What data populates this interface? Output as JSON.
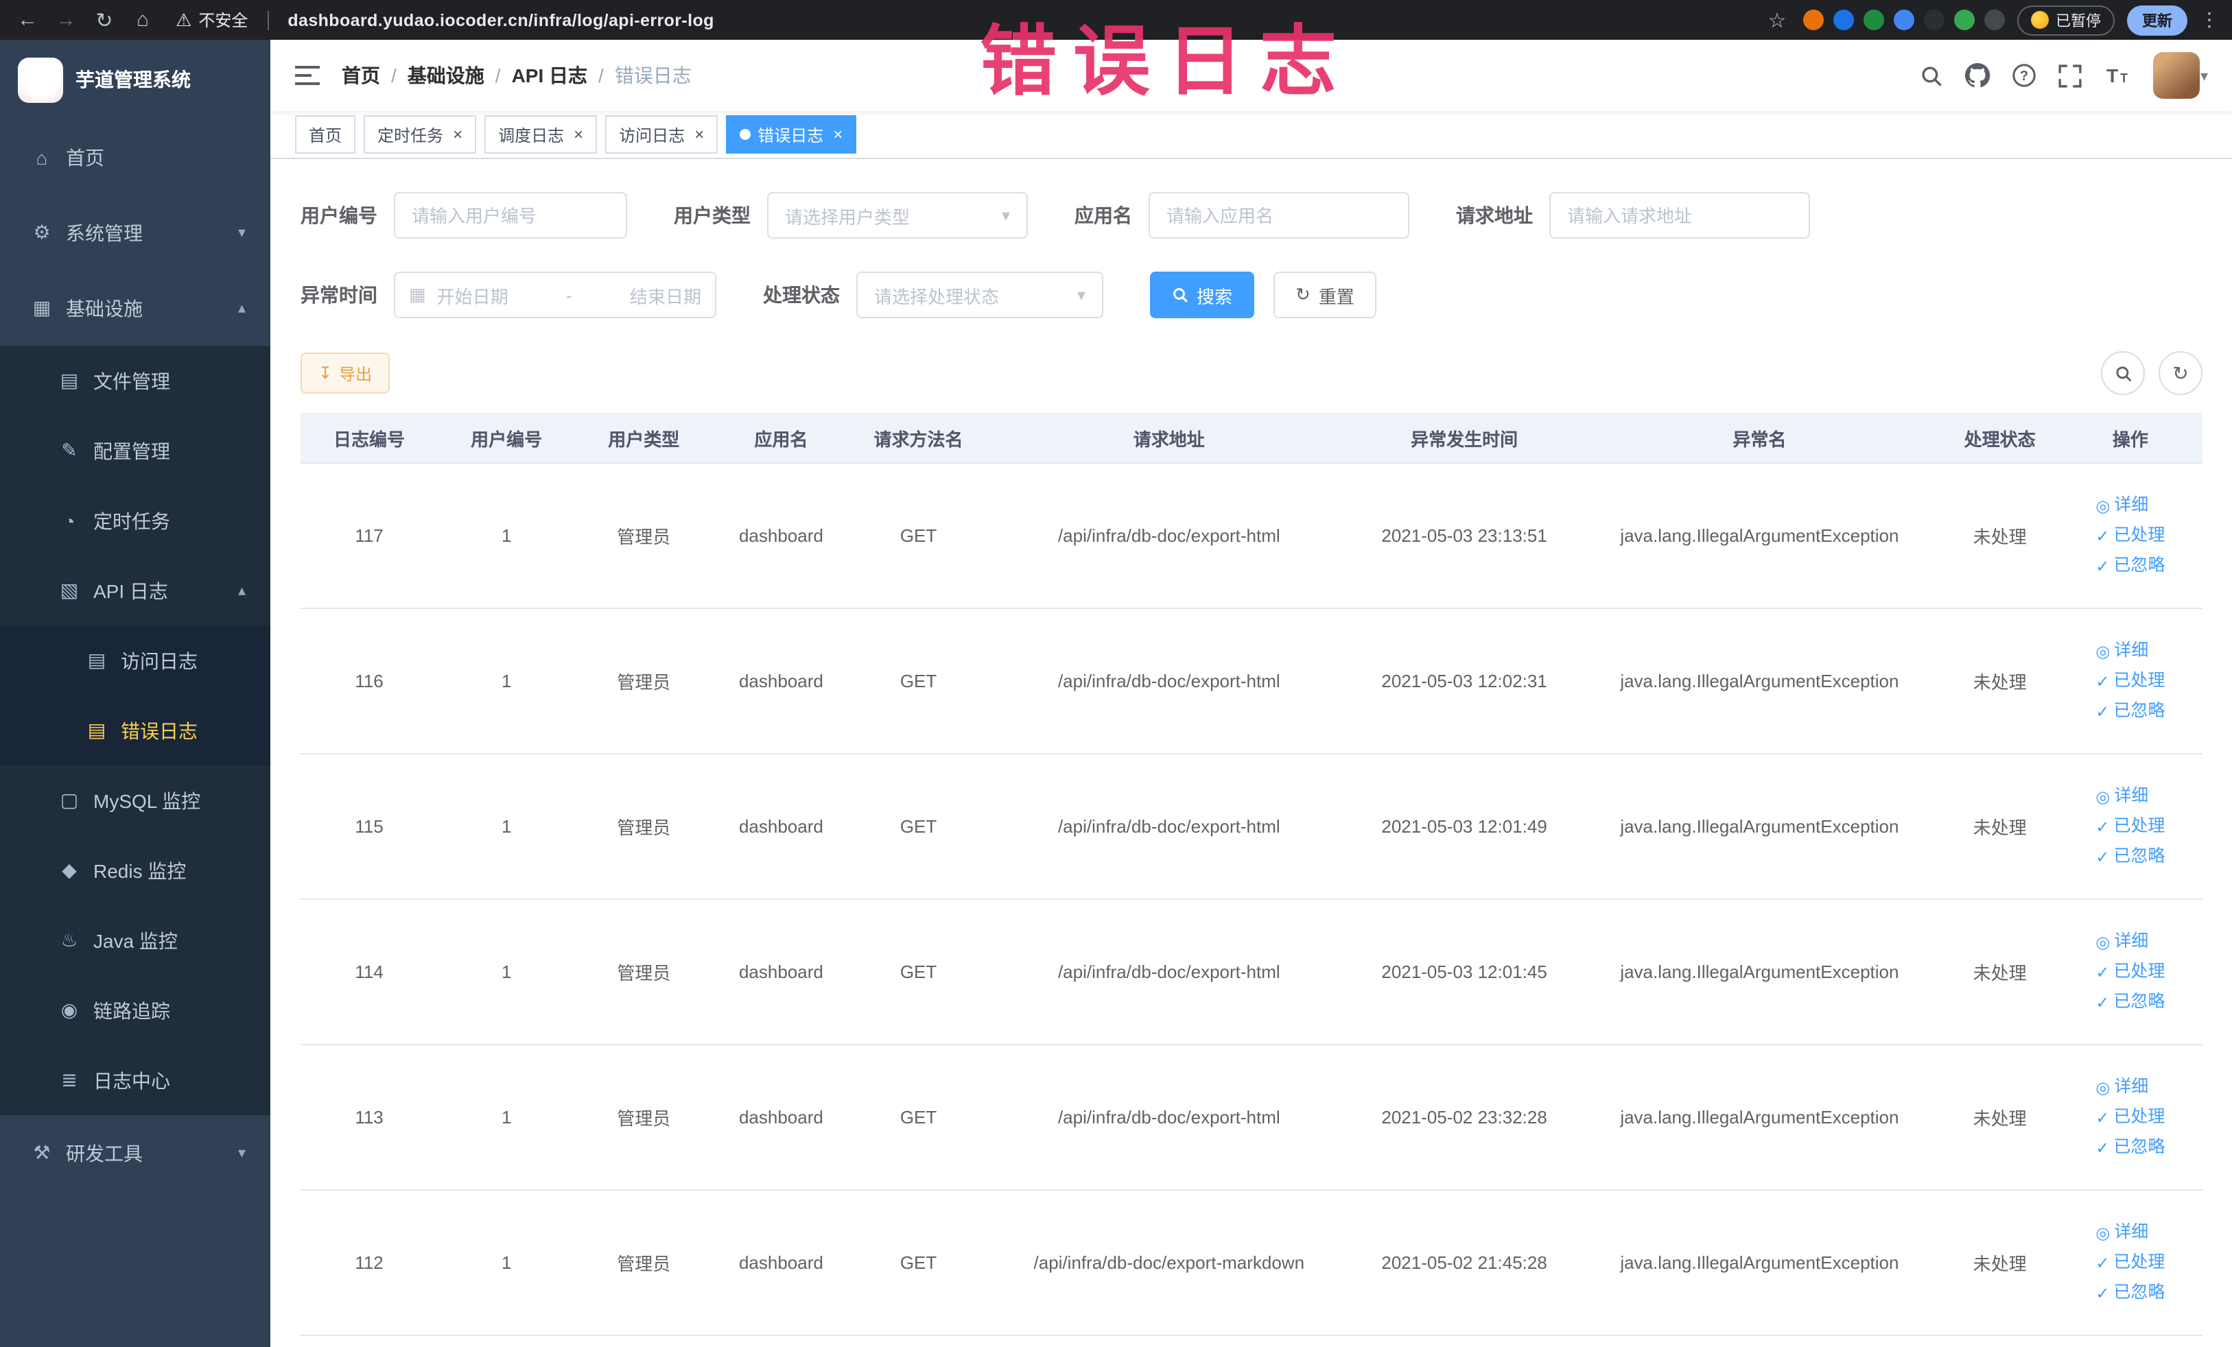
{
  "colors": {
    "accent": "#409eff",
    "sidebar_bg": "#304156",
    "active_menu": "#ffd04b",
    "annotation": "#e8336a",
    "warning_btn": "#e6a23c"
  },
  "browser": {
    "security_label": "不安全",
    "url": "dashboard.yudao.iocoder.cn/infra/log/api-error-log",
    "paused_label": "已暂停",
    "update_label": "更新",
    "extension_colors": [
      "#e8710a",
      "#1a73e8",
      "#1e8e3e",
      "#4285f4",
      "#2b2f33",
      "#34a853",
      "#45494d"
    ]
  },
  "annotation": {
    "text": "错误日志"
  },
  "sidebar": {
    "logo_title": "芋道管理系统",
    "items": [
      {
        "id": "home",
        "label": "首页",
        "icon": "home-icon",
        "level": 1
      },
      {
        "id": "system",
        "label": "系统管理",
        "icon": "gear-icon",
        "level": 1,
        "arrow": "down"
      },
      {
        "id": "infra",
        "label": "基础设施",
        "icon": "infra-icon",
        "level": 1,
        "arrow": "up"
      },
      {
        "id": "file-manage",
        "label": "文件管理",
        "icon": "file-icon",
        "level": 2
      },
      {
        "id": "config-manage",
        "label": "配置管理",
        "icon": "edit-icon",
        "level": 2
      },
      {
        "id": "cron-job",
        "label": "定时任务",
        "icon": "clock-icon",
        "level": 2
      },
      {
        "id": "api-log",
        "label": "API 日志",
        "icon": "api-icon",
        "level": 2,
        "arrow": "up"
      },
      {
        "id": "access-log",
        "label": "访问日志",
        "icon": "doc-icon",
        "level": 3
      },
      {
        "id": "error-log",
        "label": "错误日志",
        "icon": "doc-icon",
        "level": 3,
        "active": true
      },
      {
        "id": "mysql-monitor",
        "label": "MySQL 监控",
        "icon": "monitor-icon",
        "level": 2
      },
      {
        "id": "redis-monitor",
        "label": "Redis 监控",
        "icon": "redis-icon",
        "level": 2
      },
      {
        "id": "java-monitor",
        "label": "Java 监控",
        "icon": "java-icon",
        "level": 2
      },
      {
        "id": "link-trace",
        "label": "链路追踪",
        "icon": "trace-icon",
        "level": 2
      },
      {
        "id": "log-center",
        "label": "日志中心",
        "icon": "log-icon",
        "level": 2
      },
      {
        "id": "dev-tools",
        "label": "研发工具",
        "icon": "tools-icon",
        "level": 1,
        "arrow": "down"
      }
    ]
  },
  "navbar": {
    "breadcrumb": [
      "首页",
      "基础设施",
      "API 日志",
      "错误日志"
    ]
  },
  "tags": [
    {
      "label": "首页",
      "closable": false,
      "active": false
    },
    {
      "label": "定时任务",
      "closable": true,
      "active": false
    },
    {
      "label": "调度日志",
      "closable": true,
      "active": false
    },
    {
      "label": "访问日志",
      "closable": true,
      "active": false
    },
    {
      "label": "错误日志",
      "closable": true,
      "active": true
    }
  ],
  "filters": {
    "user_id": {
      "label": "用户编号",
      "placeholder": "请输入用户编号"
    },
    "user_type": {
      "label": "用户类型",
      "placeholder": "请选择用户类型"
    },
    "app_name": {
      "label": "应用名",
      "placeholder": "请输入应用名"
    },
    "request_url": {
      "label": "请求地址",
      "placeholder": "请输入请求地址"
    },
    "exception_time": {
      "label": "异常时间",
      "start_placeholder": "开始日期",
      "separator": "-",
      "end_placeholder": "结束日期"
    },
    "process_status": {
      "label": "处理状态",
      "placeholder": "请选择处理状态"
    },
    "search_button": "搜索",
    "reset_button": "重置"
  },
  "toolbar": {
    "export_button": "导出"
  },
  "table": {
    "columns": [
      "日志编号",
      "用户编号",
      "用户类型",
      "应用名",
      "请求方法名",
      "请求地址",
      "异常发生时间",
      "异常名",
      "处理状态",
      "操作"
    ],
    "row_actions": [
      {
        "id": "detail",
        "label": "详细",
        "icon": "view-icon"
      },
      {
        "id": "processed",
        "label": "已处理",
        "icon": "check-icon"
      },
      {
        "id": "ignored",
        "label": "已忽略",
        "icon": "check-icon"
      }
    ],
    "rows": [
      {
        "id": "117",
        "user_id": "1",
        "user_type": "管理员",
        "app": "dashboard",
        "method": "GET",
        "url": "/api/infra/db-doc/export-html",
        "time": "2021-05-03 23:13:51",
        "exception": "java.lang.IllegalArgumentException",
        "status": "未处理"
      },
      {
        "id": "116",
        "user_id": "1",
        "user_type": "管理员",
        "app": "dashboard",
        "method": "GET",
        "url": "/api/infra/db-doc/export-html",
        "time": "2021-05-03 12:02:31",
        "exception": "java.lang.IllegalArgumentException",
        "status": "未处理"
      },
      {
        "id": "115",
        "user_id": "1",
        "user_type": "管理员",
        "app": "dashboard",
        "method": "GET",
        "url": "/api/infra/db-doc/export-html",
        "time": "2021-05-03 12:01:49",
        "exception": "java.lang.IllegalArgumentException",
        "status": "未处理"
      },
      {
        "id": "114",
        "user_id": "1",
        "user_type": "管理员",
        "app": "dashboard",
        "method": "GET",
        "url": "/api/infra/db-doc/export-html",
        "time": "2021-05-03 12:01:45",
        "exception": "java.lang.IllegalArgumentException",
        "status": "未处理"
      },
      {
        "id": "113",
        "user_id": "1",
        "user_type": "管理员",
        "app": "dashboard",
        "method": "GET",
        "url": "/api/infra/db-doc/export-html",
        "time": "2021-05-02 23:32:28",
        "exception": "java.lang.IllegalArgumentException",
        "status": "未处理"
      },
      {
        "id": "112",
        "user_id": "1",
        "user_type": "管理员",
        "app": "dashboard",
        "method": "GET",
        "url": "/api/infra/db-doc/export-markdown",
        "time": "2021-05-02 21:45:28",
        "exception": "java.lang.IllegalArgumentException",
        "status": "未处理"
      }
    ]
  }
}
